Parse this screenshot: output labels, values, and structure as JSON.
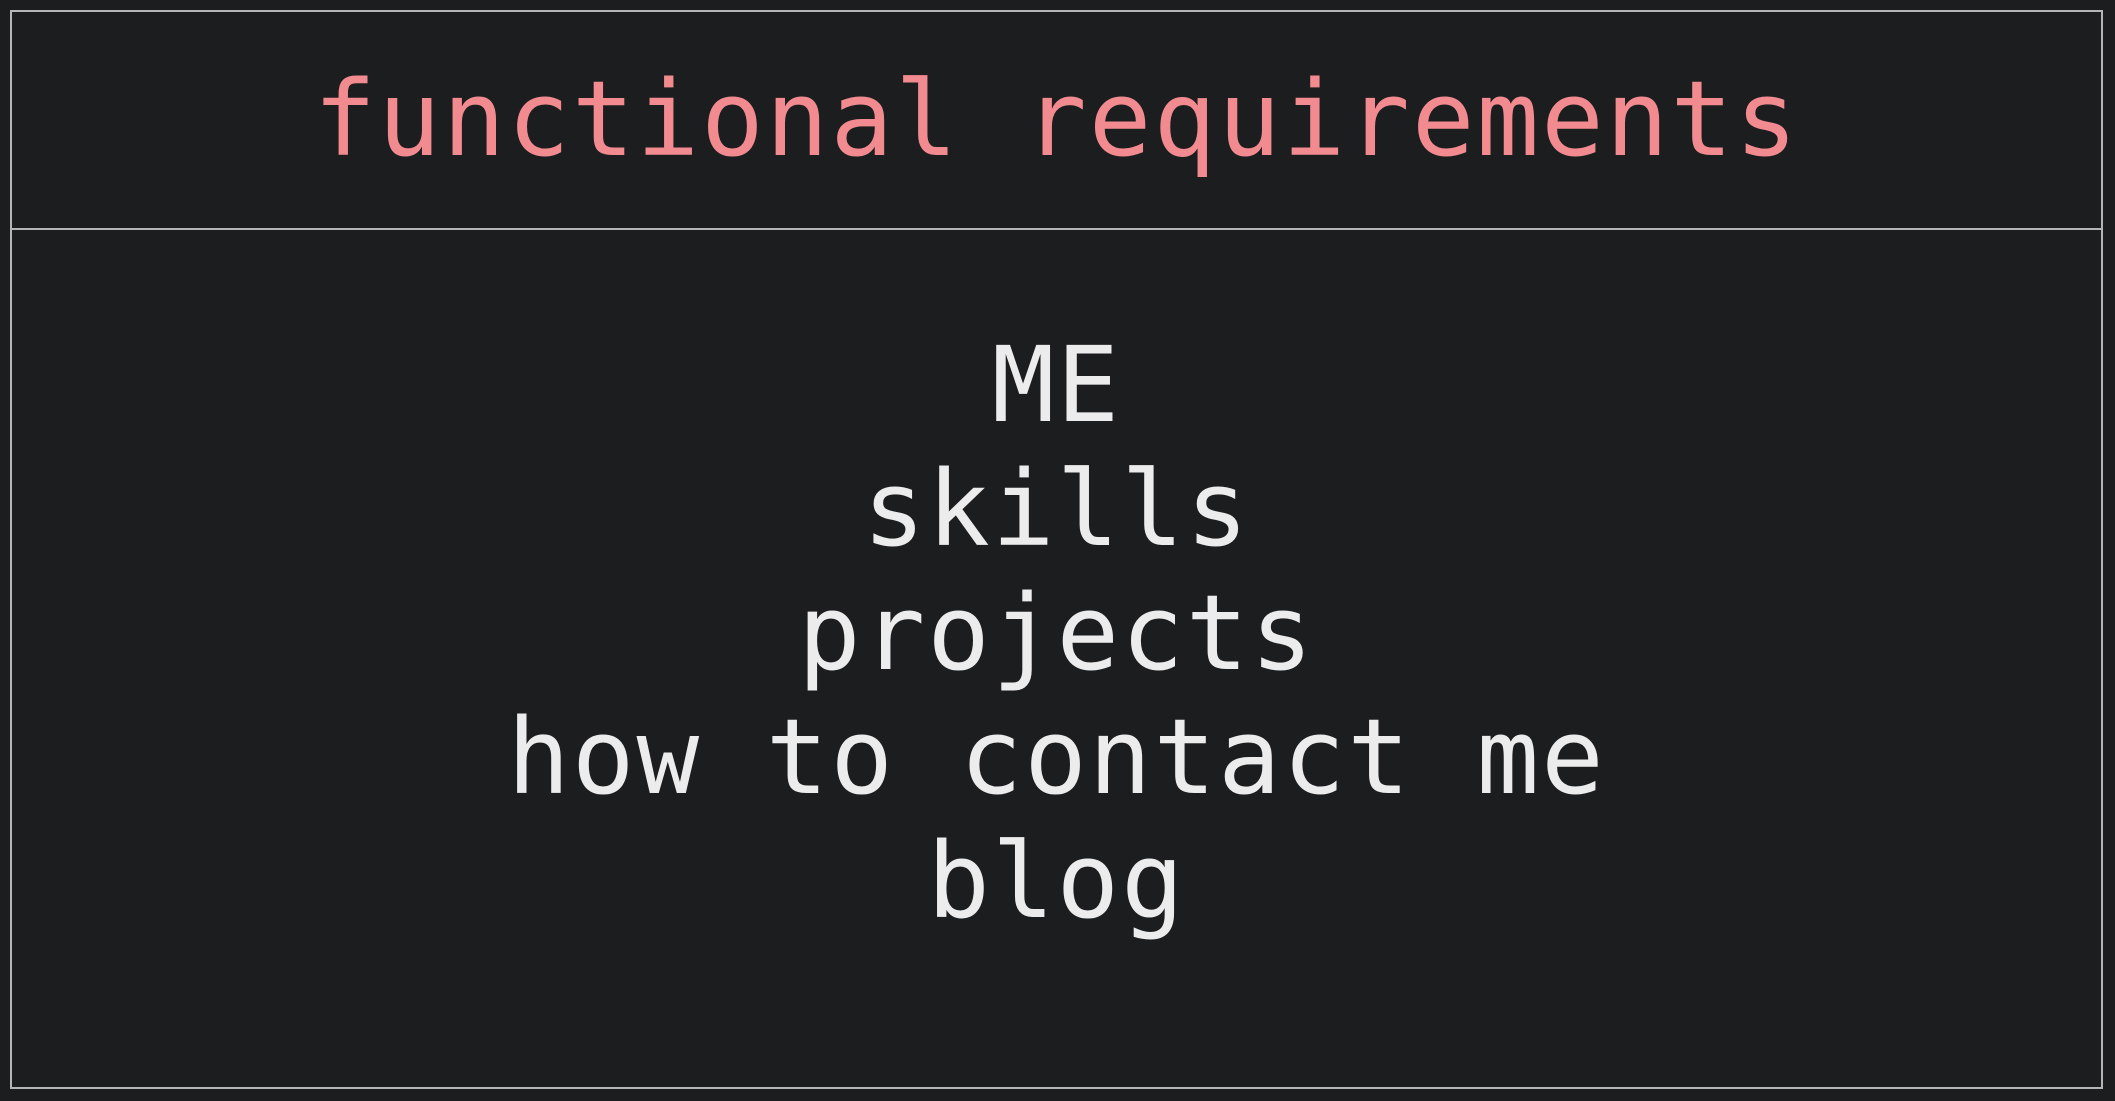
{
  "title": "functional requirements",
  "items": [
    "ME",
    "skills",
    "projects",
    "how to contact me",
    "blog"
  ],
  "colors": {
    "background": "#1c1d1f",
    "border": "#b5b5b5",
    "title": "#f28b90",
    "text": "#ececec"
  }
}
